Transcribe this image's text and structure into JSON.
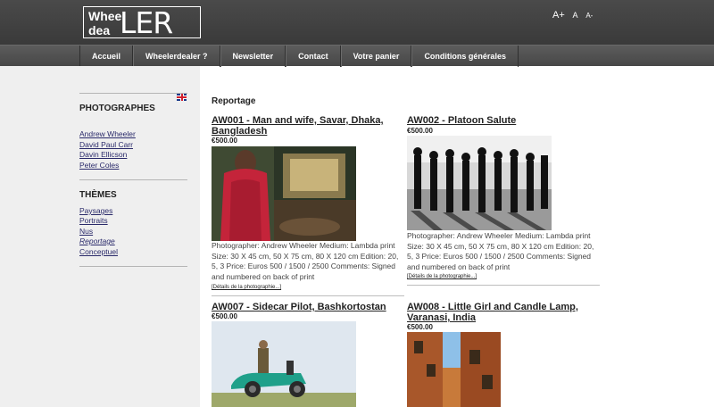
{
  "header": {
    "logo_small_1": "Whee",
    "logo_small_2": "dea",
    "logo_big": "LER",
    "font_controls": [
      "A+",
      "A",
      "A-"
    ]
  },
  "nav": {
    "items": [
      "Accueil",
      "Wheelerdealer ?",
      "Newsletter",
      "Contact",
      "Votre panier",
      "Conditions générales"
    ]
  },
  "sidebar": {
    "photographers_title": "PHOTOGRAPHES",
    "photographers": [
      "Andrew Wheeler",
      "David Paul Carr",
      "Davin Ellicson",
      "Peter Coles"
    ],
    "themes_title": "THÈMES",
    "themes": [
      "Paysages",
      "Portraits",
      "Nus",
      "Reportage",
      "Conceptuel"
    ]
  },
  "main": {
    "section_title": "Reportage",
    "details_label": "[Détails de la photographie...]",
    "items": [
      {
        "title": "AW001 - Man and wife, Savar, Dhaka, Bangladesh",
        "price": "€500.00",
        "description": "Photographer: Andrew Wheeler Medium: Lambda print Size: 30 X 45 cm, 50 X 75 cm, 80 X 120 cm Edition: 20, 5, 3 Price: Euros 500 / 1500 / 2500 Comments: Signed and numbered on back of print"
      },
      {
        "title": "AW002 - Platoon Salute",
        "price": "€500.00",
        "description": "Photographer: Andrew Wheeler Medium: Lambda print Size: 30 X 45 cm, 50 X 75 cm, 80 X 120 cm Edition: 20, 5, 3 Price: Euros 500 / 1500 / 2500 Comments: Signed and numbered on back of print"
      },
      {
        "title": "AW007 - Sidecar Pilot, Bashkortostan",
        "price": "€500.00"
      },
      {
        "title": "AW008 - Little Girl and Candle Lamp, Varanasi, India",
        "price": "€500.00"
      }
    ]
  }
}
